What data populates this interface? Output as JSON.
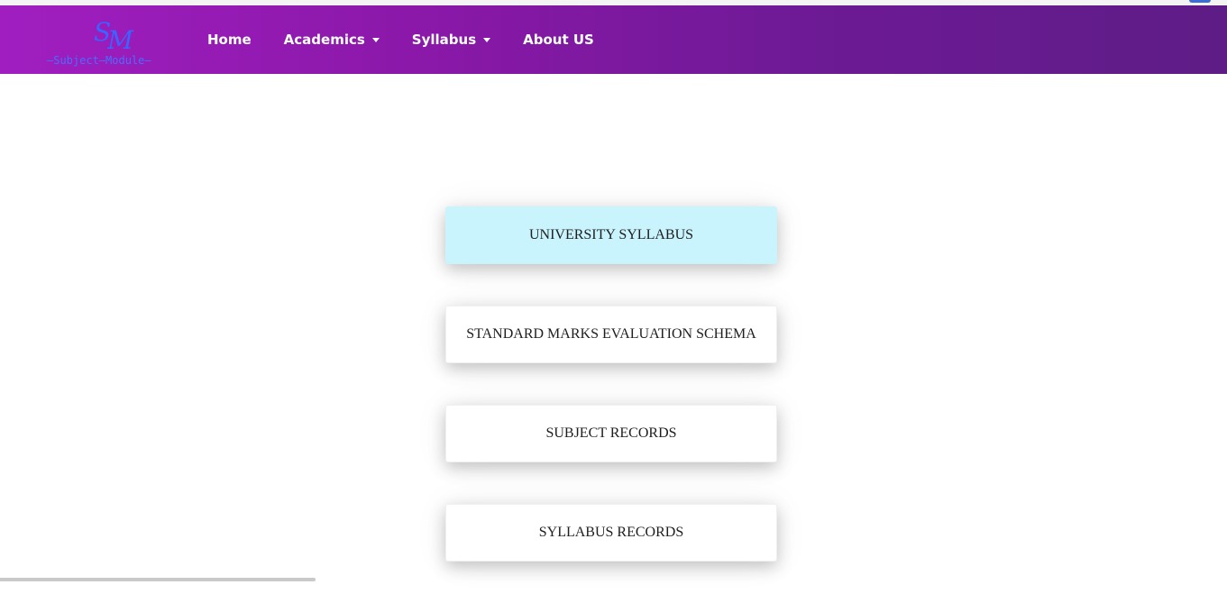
{
  "brand": {
    "mark_s": "S",
    "mark_m": "M",
    "subtitle": "—Subject—Module—"
  },
  "nav": {
    "items": [
      {
        "label": "Home",
        "dropdown": false
      },
      {
        "label": "Academics",
        "dropdown": true
      },
      {
        "label": "Syllabus",
        "dropdown": true
      },
      {
        "label": "About US",
        "dropdown": false
      }
    ]
  },
  "cards": [
    {
      "label": "UNIVERSITY SYLLABUS",
      "active": true
    },
    {
      "label": "STANDARD MARKS EVALUATION SCHEMA",
      "active": false
    },
    {
      "label": "SUBJECT RECORDS",
      "active": false
    },
    {
      "label": "SYLLABUS RECORDS",
      "active": false
    }
  ],
  "colors": {
    "navbar_start": "#a01ec0",
    "navbar_end": "#5e1c86",
    "brand_blue": "#3a63ff",
    "active_card": "#c9f4fd",
    "card_text": "#1e1e1e"
  }
}
